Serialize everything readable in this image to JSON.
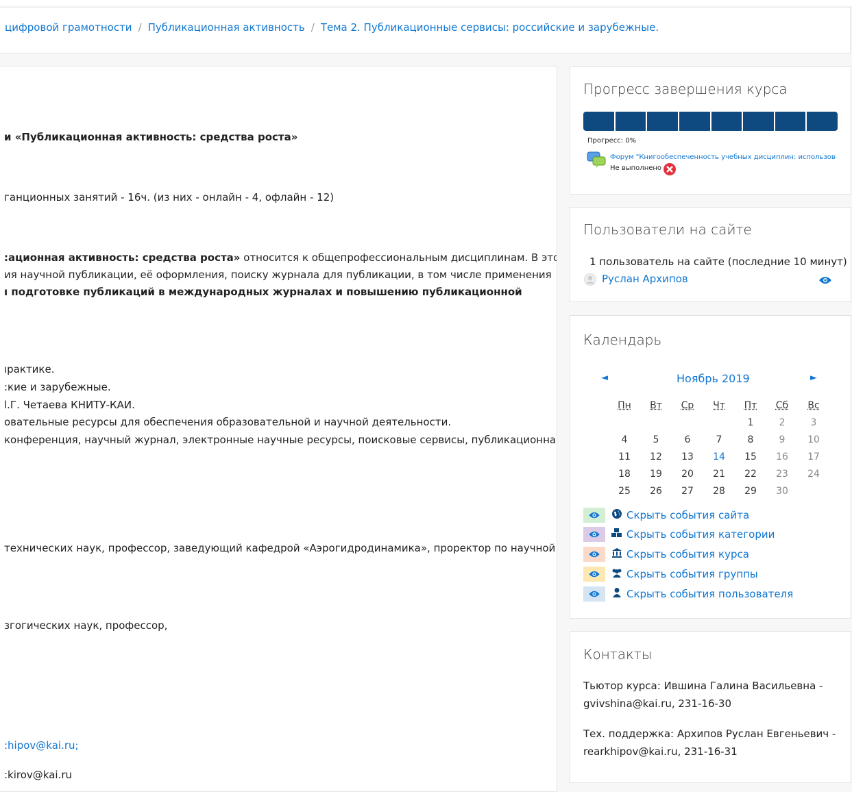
{
  "breadcrumb": [
    "цифровой грамотности",
    "Публикационная активность",
    "Тема 2. Публикационные сервисы: российские и зарубежные."
  ],
  "main": {
    "course_title": "и «Публикационная активность: средства роста»",
    "hours": "ганционных занятий - 16ч. (из них - онлайн - 4, офлайн - 12)",
    "desc_1_bold": ":ационная активность: средства роста»",
    "desc_1_rest": " относится к общепрофессиональным дисциплинам. В этом",
    "desc_2": "ия научной публикации, её оформления, поиску журнала для публикации, в том числе применения",
    "desc_3": "ı подготовке публикаций в международных журналах и повышению публикационной",
    "topic_1": "ıрактике.",
    "topic_2": ":кие и зарубежные.",
    "topic_3": "l.Г. Четаева КНИТУ-КАИ.",
    "topic_4": "овательные ресурсы для обеспечения образовательной и научной деятельности.",
    "topic_5": "конференция, научный журнал, электронные научные ресурсы, поисковые сервисы, публикационная",
    "author_1": "технических наук, профессор, заведующий кафедрой «Аэрогидродинамика», проректор по научной",
    "author_2": "згогических наук, профессор,",
    "email_1": ":hipov@kai.ru;",
    "email_2": ":kirov@kai.ru"
  },
  "progress": {
    "title": "Прогресс завершения курса",
    "progress_label": "Прогресс: 0%",
    "activity": "Форум \"Книгообеспеченность учебных дисциплин: использова",
    "status": "Не выполнено",
    "segments": 8,
    "completed_fraction": 0,
    "bar_color": "#0e4a80"
  },
  "online": {
    "title": "Пользователи на сайте",
    "summary": "1 пользователь на сайте (последние 10 минут)",
    "user": "Руслан Архипов"
  },
  "calendar": {
    "title": "Календарь",
    "month": "Ноябрь 2019",
    "prev": "◄",
    "next": "►",
    "weekdays": [
      "Пн",
      "Вт",
      "Ср",
      "Чт",
      "Пт",
      "Сб",
      "Вс"
    ],
    "weeks": [
      [
        "",
        "",
        "",
        "",
        "1",
        "2",
        "3"
      ],
      [
        "4",
        "5",
        "6",
        "7",
        "8",
        "9",
        "10"
      ],
      [
        "11",
        "12",
        "13",
        "14",
        "15",
        "16",
        "17"
      ],
      [
        "18",
        "19",
        "20",
        "21",
        "22",
        "23",
        "24"
      ],
      [
        "25",
        "26",
        "27",
        "28",
        "29",
        "30",
        ""
      ]
    ],
    "today": "14",
    "legend": [
      {
        "label": "Скрыть события сайта",
        "icon": "globe-icon",
        "bg": "#d3efd3"
      },
      {
        "label": "Скрыть события категории",
        "icon": "cubes-icon",
        "bg": "#dccbe6"
      },
      {
        "label": "Скрыть события курса",
        "icon": "institution-icon",
        "bg": "#fbd9c8"
      },
      {
        "label": "Скрыть события группы",
        "icon": "users-icon",
        "bg": "#fde8b3"
      },
      {
        "label": "Скрыть события пользователя",
        "icon": "user-icon",
        "bg": "#d4e4f2"
      }
    ]
  },
  "contacts": {
    "title": "Контакты",
    "tutor_1": "Тьютор курса: Ившина Галина Васильевна -",
    "tutor_2": "gvivshina@kai.ru, 231-16-30",
    "support_1": "Тех. поддержка: Архипов Руслан Евгеньевич -",
    "support_2": "rearkhipov@kai.ru, 231-16-31"
  },
  "colors": {
    "link": "#1177d1",
    "error": "#e5303d",
    "eye": "#1177d1"
  }
}
